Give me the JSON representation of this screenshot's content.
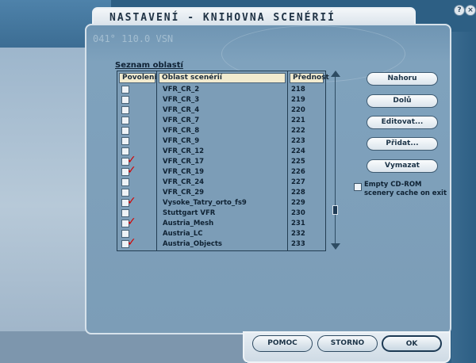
{
  "window": {
    "title": "NASTAVENÍ - KNIHOVNA SCENÉRIÍ",
    "help_label": "?",
    "close_label": "×"
  },
  "decor": {
    "text": "041° 110.0 VSN"
  },
  "list": {
    "caption": "Seznam oblastí",
    "headers": {
      "enabled": "Povolení",
      "name": "Oblast scenérií",
      "priority": "Přednost"
    },
    "rows": [
      {
        "checked": false,
        "name": "VFR_CR_2",
        "priority": "218"
      },
      {
        "checked": false,
        "name": "VFR_CR_3",
        "priority": "219"
      },
      {
        "checked": false,
        "name": "VFR_CR_4",
        "priority": "220"
      },
      {
        "checked": false,
        "name": "VFR_CR_7",
        "priority": "221"
      },
      {
        "checked": false,
        "name": "VFR_CR_8",
        "priority": "222"
      },
      {
        "checked": false,
        "name": "VFR_CR_9",
        "priority": "223"
      },
      {
        "checked": false,
        "name": "VFR_CR_12",
        "priority": "224"
      },
      {
        "checked": true,
        "name": "VFR_CR_17",
        "priority": "225"
      },
      {
        "checked": true,
        "name": "VFR_CR_19",
        "priority": "226"
      },
      {
        "checked": false,
        "name": "VFR_CR_24",
        "priority": "227"
      },
      {
        "checked": false,
        "name": "VFR_CR_29",
        "priority": "228"
      },
      {
        "checked": true,
        "name": "Vysoke_Tatry_orto_fs9",
        "priority": "229"
      },
      {
        "checked": false,
        "name": "Stuttgart VFR",
        "priority": "230"
      },
      {
        "checked": true,
        "name": "Austria_Mesh",
        "priority": "231"
      },
      {
        "checked": false,
        "name": "Austria_LC",
        "priority": "232"
      },
      {
        "checked": true,
        "name": "Austria_Objects",
        "priority": "233"
      }
    ],
    "check_glyph": "✓"
  },
  "actions": {
    "up": "Nahoru",
    "down": "Dolů",
    "edit": "Editovat...",
    "add": "Přidat...",
    "delete": "Vymazat"
  },
  "cdrom": {
    "label": "Empty CD-ROM scenery cache on exit",
    "checked": false
  },
  "footer": {
    "help": "POMOC",
    "cancel": "STORNO",
    "ok": "OK"
  }
}
